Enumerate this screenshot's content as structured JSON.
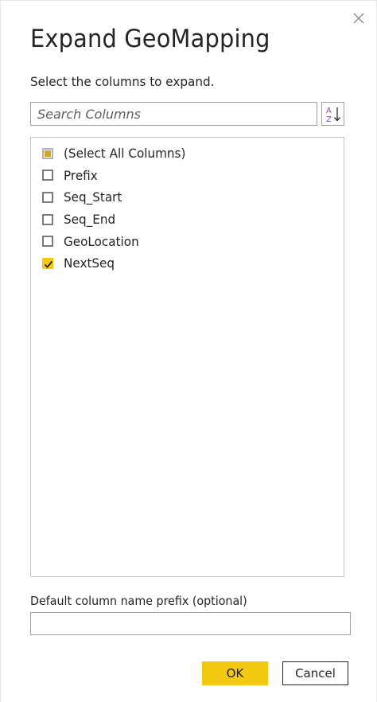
{
  "dialog": {
    "title": "Expand GeoMapping",
    "subtitle": "Select the columns to expand.",
    "close_icon": "close-icon"
  },
  "search": {
    "placeholder": "Search Columns",
    "value": "",
    "sort_icon": "sort-az-icon"
  },
  "columns": {
    "select_all": {
      "label": "(Select All Columns)",
      "state": "partial"
    },
    "items": [
      {
        "label": "Prefix",
        "checked": false
      },
      {
        "label": "Seq_Start",
        "checked": false
      },
      {
        "label": "Seq_End",
        "checked": false
      },
      {
        "label": "GeoLocation",
        "checked": false
      },
      {
        "label": "NextSeq",
        "checked": true
      }
    ]
  },
  "prefix": {
    "label": "Default column name prefix (optional)",
    "value": ""
  },
  "buttons": {
    "ok_label": "OK",
    "cancel_label": "Cancel"
  },
  "colors": {
    "accent": "#f2c811",
    "partial_fill": "#d4a52a",
    "text": "#252423",
    "border": "#9f9f9f"
  }
}
